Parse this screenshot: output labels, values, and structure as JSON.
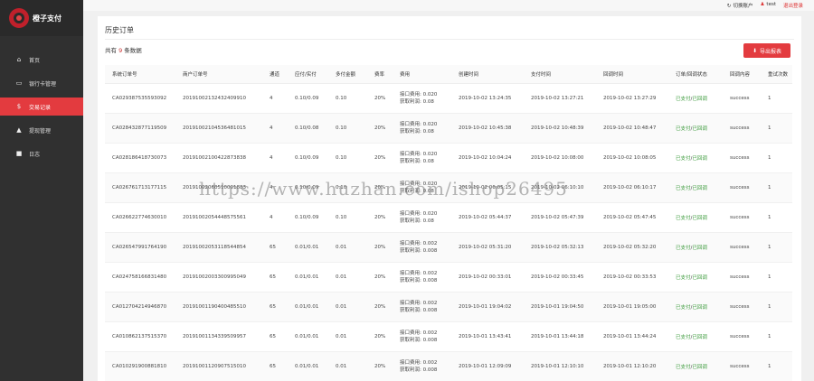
{
  "app": {
    "brand": "橙子支付",
    "nav": [
      {
        "label": "首页",
        "icon": "home-icon"
      },
      {
        "label": "银行卡管理",
        "icon": "card-icon"
      },
      {
        "label": "交易记录",
        "icon": "dollar-icon"
      },
      {
        "label": "提现管理",
        "icon": "withdraw-icon"
      },
      {
        "label": "日志",
        "icon": "log-icon"
      }
    ]
  },
  "topbar": {
    "refresh": "切换账户",
    "user": "test",
    "logout": "退出登录"
  },
  "page": {
    "title": "历史订单",
    "summary_prefix": "共有",
    "count": "9",
    "summary_suffix": "条数据",
    "export_label": "导出报表"
  },
  "table": {
    "headers": [
      "系统订单号",
      "商户订单号",
      "通道",
      "应付/实付",
      "多付金额",
      "费率",
      "费用",
      "创建时间",
      "支付时间",
      "回调时间",
      "订单/回调状态",
      "回调内容",
      "重试次数"
    ],
    "fee_label_a": "接口费用:",
    "fee_label_b": "获取利润:",
    "rows": [
      {
        "sys": "CA029387535593092",
        "merchant": "20191002132432409910",
        "channel": "4",
        "pay": "0.10/0.09",
        "over": "0.10",
        "rate": "20%",
        "fee_a": "0.020",
        "fee_b": "0.08",
        "created": "2019-10-02 13:24:35",
        "paid": "2019-10-02 13:27:21",
        "callback": "2019-10-02 13:27:29",
        "st_a": "已支付",
        "st_b": "已回调",
        "content": "success",
        "retry": "1"
      },
      {
        "sys": "CA028432877119509",
        "merchant": "20191002104536481015",
        "channel": "4",
        "pay": "0.10/0.08",
        "over": "0.10",
        "rate": "20%",
        "fee_a": "0.020",
        "fee_b": "0.08",
        "created": "2019-10-02 10:45:38",
        "paid": "2019-10-02 10:48:39",
        "callback": "2019-10-02 10:48:47",
        "st_a": "已支付",
        "st_b": "已回调",
        "content": "success",
        "retry": "1"
      },
      {
        "sys": "CA028186418730073",
        "merchant": "20191002100422873838",
        "channel": "4",
        "pay": "0.10/0.09",
        "over": "0.10",
        "rate": "20%",
        "fee_a": "0.020",
        "fee_b": "0.08",
        "created": "2019-10-02 10:04:24",
        "paid": "2019-10-02 10:08:00",
        "callback": "2019-10-02 10:08:05",
        "st_a": "已支付",
        "st_b": "已回调",
        "content": "success",
        "retry": "1"
      },
      {
        "sys": "CA026761713177115",
        "merchant": "20191002060510001883",
        "channel": "4",
        "pay": "0.10/0.09",
        "over": "0.10",
        "rate": "20%",
        "fee_a": "0.020",
        "fee_b": "0.08",
        "created": "2019-10-02 06:05:15",
        "paid": "2019-10-02 06:10:10",
        "callback": "2019-10-02 06:10:17",
        "st_a": "已支付",
        "st_b": "已回调",
        "content": "success",
        "retry": "1"
      },
      {
        "sys": "CA026622774630010",
        "merchant": "20191002054448575561",
        "channel": "4",
        "pay": "0.10/0.09",
        "over": "0.10",
        "rate": "20%",
        "fee_a": "0.020",
        "fee_b": "0.08",
        "created": "2019-10-02 05:44:37",
        "paid": "2019-10-02 05:47:39",
        "callback": "2019-10-02 05:47:45",
        "st_a": "已支付",
        "st_b": "已回调",
        "content": "success",
        "retry": "1"
      },
      {
        "sys": "CA026547991764190",
        "merchant": "20191002053118544854",
        "channel": "65",
        "pay": "0.01/0.01",
        "over": "0.01",
        "rate": "20%",
        "fee_a": "0.002",
        "fee_b": "0.008",
        "created": "2019-10-02 05:31:20",
        "paid": "2019-10-02 05:32:13",
        "callback": "2019-10-02 05:32:20",
        "st_a": "已支付",
        "st_b": "已回调",
        "content": "success",
        "retry": "1"
      },
      {
        "sys": "CA024758166831480",
        "merchant": "20191002003300995049",
        "channel": "65",
        "pay": "0.01/0.01",
        "over": "0.01",
        "rate": "20%",
        "fee_a": "0.002",
        "fee_b": "0.008",
        "created": "2019-10-02 00:33:01",
        "paid": "2019-10-02 00:33:45",
        "callback": "2019-10-02 00:33:53",
        "st_a": "已支付",
        "st_b": "已回调",
        "content": "success",
        "retry": "1"
      },
      {
        "sys": "CA012704214946870",
        "merchant": "20191001190400485510",
        "channel": "65",
        "pay": "0.01/0.01",
        "over": "0.01",
        "rate": "20%",
        "fee_a": "0.002",
        "fee_b": "0.008",
        "created": "2019-10-01 19:04:02",
        "paid": "2019-10-01 19:04:50",
        "callback": "2019-10-01 19:05:00",
        "st_a": "已支付",
        "st_b": "已回调",
        "content": "success",
        "retry": "1"
      },
      {
        "sys": "CA010862137515370",
        "merchant": "20191001134339509957",
        "channel": "65",
        "pay": "0.01/0.01",
        "over": "0.01",
        "rate": "20%",
        "fee_a": "0.002",
        "fee_b": "0.008",
        "created": "2019-10-01 13:43:41",
        "paid": "2019-10-01 13:44:18",
        "callback": "2019-10-01 13:44:24",
        "st_a": "已支付",
        "st_b": "已回调",
        "content": "success",
        "retry": "1"
      },
      {
        "sys": "CA010291900881810",
        "merchant": "20191001120907515010",
        "channel": "65",
        "pay": "0.01/0.01",
        "over": "0.01",
        "rate": "20%",
        "fee_a": "0.002",
        "fee_b": "0.008",
        "created": "2019-10-01 12:09:09",
        "paid": "2019-10-01 12:10:10",
        "callback": "2019-10-01 12:10:20",
        "st_a": "已支付",
        "st_b": "已回调",
        "content": "success",
        "retry": "1"
      }
    ]
  },
  "watermark": "https://www.huzhan.com/ishop26495",
  "colors": {
    "accent": "#e33b3f",
    "sidebar": "#303030",
    "paid": "#3a9a3a"
  }
}
